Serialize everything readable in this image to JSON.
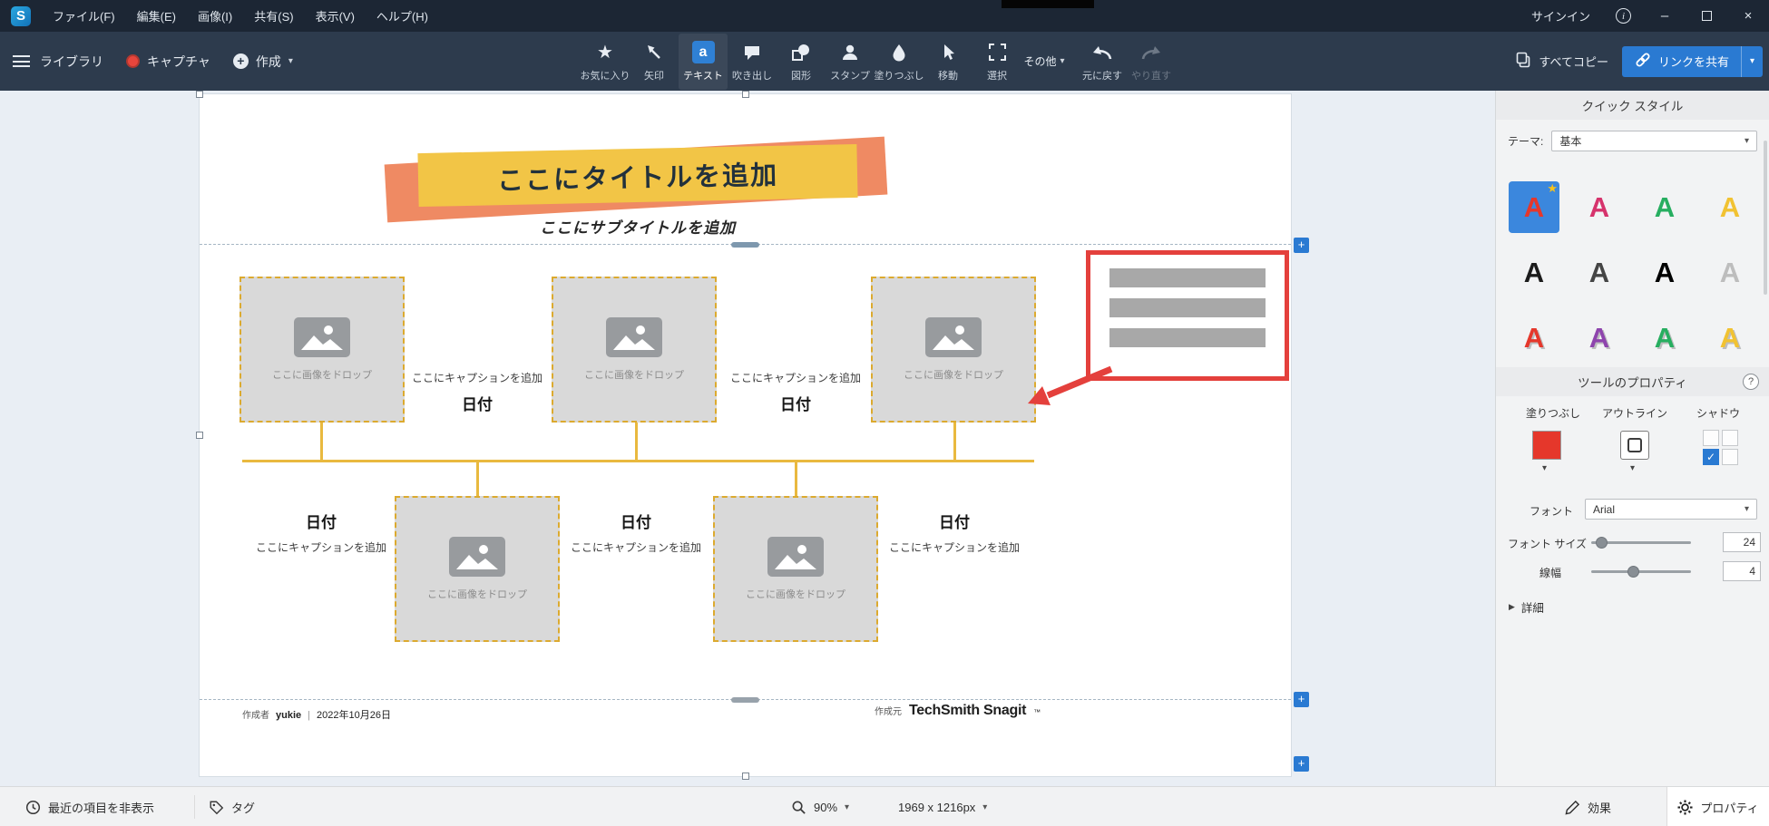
{
  "titlebar": {
    "app_letter": "S",
    "menus": [
      {
        "label": "ファイル(F)"
      },
      {
        "label": "編集(E)"
      },
      {
        "label": "画像(I)"
      },
      {
        "label": "共有(S)"
      },
      {
        "label": "表示(V)"
      },
      {
        "label": "ヘルプ(H)"
      }
    ],
    "signin": "サインイン"
  },
  "icons": {
    "star": "★",
    "caret_down": "▾",
    "caret_right": "▶",
    "plus": "+",
    "check": "✓",
    "info": "i",
    "close": "×",
    "minimize": "–",
    "question": "?"
  },
  "toolbar": {
    "library": "ライブラリ",
    "capture": "キャプチャ",
    "create": "作成",
    "tools": [
      {
        "label": "お気に入り"
      },
      {
        "label": "矢印"
      },
      {
        "label": "テキスト",
        "selected": true
      },
      {
        "label": "吹き出し"
      },
      {
        "label": "図形"
      },
      {
        "label": "スタンプ"
      },
      {
        "label": "塗りつぶし"
      },
      {
        "label": "移動"
      },
      {
        "label": "選択"
      }
    ],
    "text_tool_glyph": "a",
    "more": "その他",
    "undo": "元に戻す",
    "redo": "やり直す",
    "copy_all": "すべてコピー",
    "share_link": "リンクを共有",
    "accent_color": "#2a7ad2"
  },
  "canvas": {
    "title": "ここにタイトルを追加",
    "subtitle": "ここにサブタイトルを追加",
    "drop_label": "ここに画像をドロップ",
    "caption_label": "ここにキャプションを追加",
    "date_label": "日付",
    "banner_yellow": "#f2c546",
    "banner_orange": "#ef8a63",
    "timeline_color": "#e9b93f",
    "annotation_color": "#e4403c",
    "footer": {
      "author_prefix": "作成者",
      "author": "yukie",
      "separator": "|",
      "date": "2022年10月26日",
      "source_prefix": "作成元",
      "brand": "TechSmith Snagit",
      "tm": "™"
    }
  },
  "panel": {
    "quick_styles_title": "クイック スタイル",
    "theme_label": "テーマ:",
    "theme_value": "基本",
    "style_letter": "A",
    "styles": [
      {
        "css": "color:#e5372b"
      },
      {
        "css": "color:#d6336c"
      },
      {
        "css": "color:#27ae60"
      },
      {
        "css": "color:#f1c232"
      },
      {
        "css": "color:#1b1b1b"
      },
      {
        "css": "color:#444444"
      },
      {
        "css": "color:#000000"
      },
      {
        "css": "color:#bdbdbd"
      },
      {
        "css": "color:#e5372b;text-shadow:2px 2px 0 rgba(0,0,0,0.22)"
      },
      {
        "css": "color:#8e44ad;text-shadow:2px 2px 0 rgba(0,0,0,0.22)"
      },
      {
        "css": "color:#27ae60;text-shadow:2px 2px 0 rgba(0,0,0,0.22)"
      },
      {
        "css": "color:#f1c232;text-shadow:2px 2px 0 rgba(0,0,0,0.22)"
      }
    ],
    "tool_properties_title": "ツールのプロパティ",
    "fill_label": "塗りつぶし",
    "fill_swatch_css": "background:#e5372b",
    "outline_label": "アウトライン",
    "shadow_label": "シャドウ",
    "font_label": "フォント",
    "font_value": "Arial",
    "font_size_label": "フォント サイズ",
    "font_size_value": "24",
    "line_width_label": "線幅",
    "line_width_value": "4",
    "details_label": "詳細"
  },
  "statusbar": {
    "hide_recent": "最近の項目を非表示",
    "tags": "タグ",
    "zoom": "90%",
    "canvas_size": "1969 x 1216px",
    "effects": "効果",
    "properties": "プロパティ"
  }
}
